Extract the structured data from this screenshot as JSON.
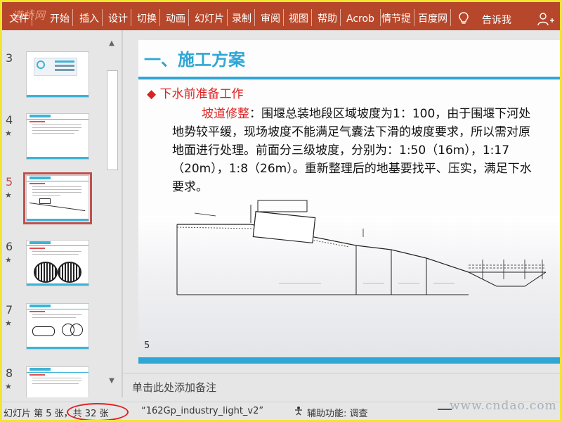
{
  "watermark_top": "道桥网",
  "ribbon": {
    "tabs": [
      "文件",
      "开始",
      "插入",
      "设计",
      "切换",
      "动画",
      "幻灯片",
      "录制",
      "审阅",
      "视图",
      "帮助",
      "Acrob",
      "情节提",
      "百度网"
    ],
    "tell_me": "告诉我"
  },
  "thumbnails": [
    {
      "num": "3",
      "star": ""
    },
    {
      "num": "4",
      "star": "★"
    },
    {
      "num": "5",
      "star": "★",
      "active": true
    },
    {
      "num": "6",
      "star": "★"
    },
    {
      "num": "7",
      "star": "★"
    },
    {
      "num": "8",
      "star": "★"
    }
  ],
  "slide": {
    "title": "一、施工方案",
    "subhead_bullet": "◆",
    "subhead": "下水前准备工作",
    "body_highlight": "坡道修整",
    "body_text": "：围堰总装地段区域坡度为1：100，由于围堰下河处地势较平缓，现场坡度不能满足气囊法下滑的坡度要求，所以需对原地面进行处理。前面分三级坡度，分别为：1:50（16m），1:17（20m），1:8（26m）。重新整理后的地基要找平、压实，满足下水要求。",
    "page_number": "5"
  },
  "notes_placeholder": "单击此处添加备注",
  "status": {
    "slide_info": "幻灯片 第 5 张，共 32 张",
    "template": "“162Gp_industry_light_v2”",
    "accessibility": "辅助功能: 调查"
  },
  "watermark_bottom": "www.cndao.com",
  "colors": {
    "ribbon": "#b7472a",
    "accent": "#2fa6d6",
    "highlight": "#e02020",
    "frame": "#f2e52d"
  }
}
